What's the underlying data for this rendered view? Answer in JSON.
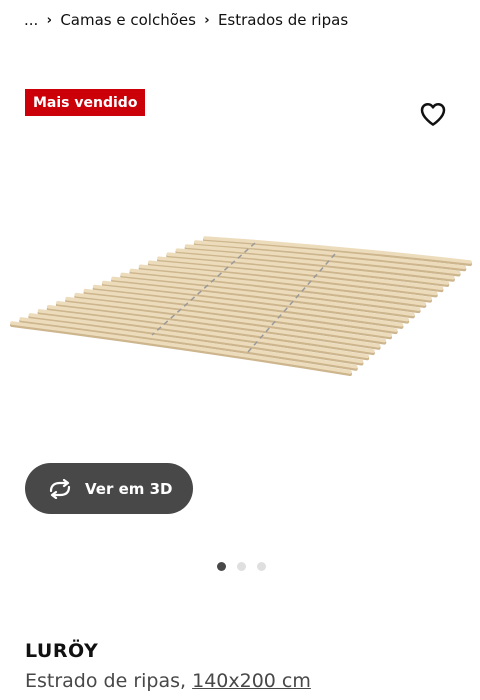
{
  "breadcrumb": {
    "ellipsis": "...",
    "items": [
      "Camas e colchões",
      "Estrados de ripas"
    ]
  },
  "badge": {
    "label": "Mais vendido",
    "color": "#cc0008"
  },
  "favorite": {
    "icon": "heart-outline-icon"
  },
  "view_3d": {
    "label": "Ver em 3D",
    "icon": "rotate-arrows-icon"
  },
  "carousel": {
    "total": 3,
    "active_index": 0
  },
  "product": {
    "name": "LURÖY",
    "description": "Estrado de ripas,",
    "size": "140x200 cm"
  },
  "colors": {
    "badge": "#cc0008",
    "button": "#484848",
    "text": "#111111"
  }
}
